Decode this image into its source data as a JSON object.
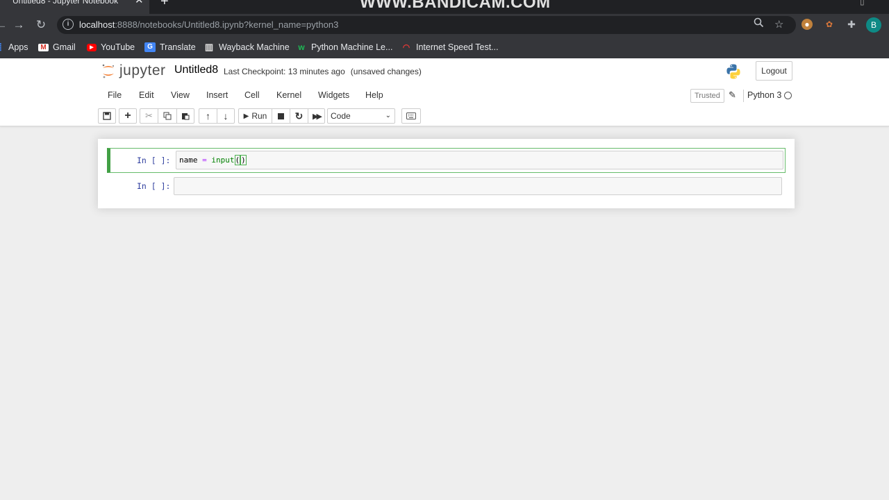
{
  "browser": {
    "tab_title": "Untitled8 - Jupyter Notebook",
    "close_glyph": "✕",
    "new_tab_glyph": "+",
    "watermark": "WWW.BANDICAM.COM",
    "url_host": "localhost",
    "url_rest": ":8888/notebooks/Untitled8.ipynb?kernel_name=python3",
    "avatar_letter": "B",
    "bookmarks": [
      {
        "label": "Apps",
        "icon": "apps-grid-icon"
      },
      {
        "label": "Gmail",
        "icon": "gmail-icon"
      },
      {
        "label": "YouTube",
        "icon": "youtube-icon"
      },
      {
        "label": "Translate",
        "icon": "translate-icon"
      },
      {
        "label": "Wayback Machine",
        "icon": "wayback-icon"
      },
      {
        "label": "Python Machine Le...",
        "icon": "bookmark-favicon-icon"
      },
      {
        "label": "Internet Speed Test...",
        "icon": "speedtest-icon"
      }
    ]
  },
  "jupyter": {
    "logo_text": "jupyter",
    "notebook_name": "Untitled8",
    "checkpoint": "Last Checkpoint: 13 minutes ago",
    "unsaved": "(unsaved changes)",
    "logout": "Logout",
    "menu": [
      "File",
      "Edit",
      "View",
      "Insert",
      "Cell",
      "Kernel",
      "Widgets",
      "Help"
    ],
    "trusted": "Trusted",
    "kernel": "Python 3",
    "run_label": "Run",
    "cell_type": "Code"
  },
  "cells": [
    {
      "prompt": "In [ ]:",
      "code_var": "name",
      "code_op": "=",
      "code_fn": "input",
      "code_open": "(",
      "code_close": ")"
    },
    {
      "prompt": "In [ ]:"
    }
  ],
  "colors": {
    "selected_cell_border": "#42a045",
    "prompt_color": "#303f9f",
    "browser_toolbar": "#35363a"
  }
}
